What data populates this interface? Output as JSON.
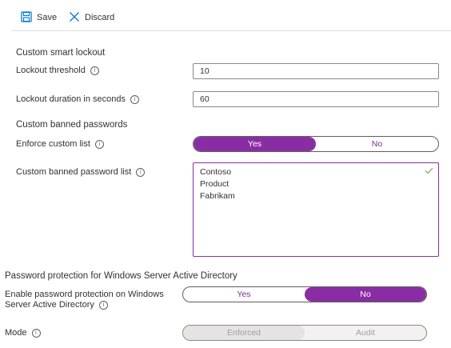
{
  "toolbar": {
    "save_label": "Save",
    "discard_label": "Discard"
  },
  "smart_lockout": {
    "section_title": "Custom smart lockout",
    "threshold_label": "Lockout threshold",
    "threshold_value": "10",
    "duration_label": "Lockout duration in seconds",
    "duration_value": "60"
  },
  "banned_passwords": {
    "section_title": "Custom banned passwords",
    "enforce_label": "Enforce custom list",
    "enforce_options": [
      "Yes",
      "No"
    ],
    "enforce_selected": "Yes",
    "list_label": "Custom banned password list",
    "list_items": [
      "Contoso",
      "Product",
      "Fabrikam"
    ]
  },
  "ad_protection": {
    "section_title": "Password protection for Windows Server Active Directory",
    "enable_label_line1": "Enable password protection on Windows",
    "enable_label_line2": "Server Active Directory",
    "enable_options": [
      "Yes",
      "No"
    ],
    "enable_selected": "No",
    "mode_label": "Mode",
    "mode_options": [
      "Enforced",
      "Audit"
    ],
    "mode_selected": "Enforced"
  },
  "colors": {
    "accent": "#8a2da5",
    "icon_blue": "#0078d4",
    "valid_green": "#8db36a"
  },
  "icons": {
    "save": "save-icon",
    "discard": "close-icon",
    "info": "info-icon",
    "valid": "checkmark-icon"
  }
}
